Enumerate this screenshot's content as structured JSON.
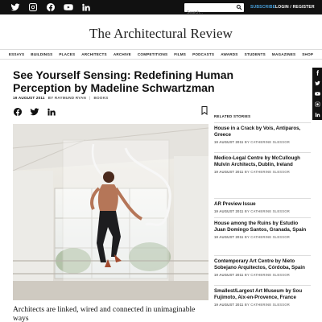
{
  "topbar": {
    "social_icons": [
      "twitter-icon",
      "instagram-icon",
      "facebook-icon",
      "youtube-icon",
      "linkedin-icon"
    ],
    "search_placeholder": "Search...",
    "subscribe_label": "SUBSCRIBE",
    "login_label": "LOGIN / REGISTER",
    "colors": {
      "bar": "#111111",
      "subscribe": "#4aa3df"
    }
  },
  "masthead": {
    "logo": "The Architectural Review"
  },
  "nav": {
    "items": [
      "ESSAYS",
      "BUILDINGS",
      "PLACES",
      "ARCHITECTS",
      "ARCHIVE",
      "COMPETITIONS",
      "FILMS",
      "PODCASTS",
      "AWARDS",
      "STUDENTS",
      "MAGAZINES",
      "SHOP"
    ]
  },
  "article": {
    "title": "See Yourself Sensing: Redefining Human Perception by Madeline Schwartzman",
    "date": "19 AUGUST 2011",
    "author": "BY RAYMUND RYAN",
    "section": "BOOKS",
    "caption": "Architects are linked, wired and connected in unimaginable ways"
  },
  "sidebar": {
    "heading": "RELATED STORIES",
    "stories": [
      {
        "title": "House in a Crack by Vois, Antiparos, Greece",
        "date": "19 AUGUST 2011",
        "author": "BY CATHERINE SLESSOR"
      },
      {
        "title": "Medico-Legal Centre by McCullough Mulvin Architects, Dublin, Ireland",
        "date": "19 AUGUST 2011",
        "author": "BY CATHERINE SLESSOR"
      },
      {
        "title": "AR Preview Issue",
        "date": "19 AUGUST 2011",
        "author": "BY CATHERINE SLESSOR"
      },
      {
        "title": "House among the Ruins by Estudio Juan Domingo Santos, Granada, Spain",
        "date": "19 AUGUST 2011",
        "author": "BY CATHERINE SLESSOR"
      },
      {
        "title": "Contemporary Art Centre by Nieto Sobejano Arquitectos, Córdoba, Spain",
        "date": "19 AUGUST 2011",
        "author": "BY CATHERINE SLESSOR"
      },
      {
        "title": "Smallest/Largest Art Museum by Sou Fujimoto, Aix-en-Provence, France",
        "date": "19 AUGUST 2011",
        "author": "BY CATHERINE SLESSOR"
      }
    ]
  },
  "side_share_icons": [
    "facebook-icon",
    "twitter-icon",
    "youtube-icon",
    "instagram-icon",
    "linkedin-icon"
  ]
}
